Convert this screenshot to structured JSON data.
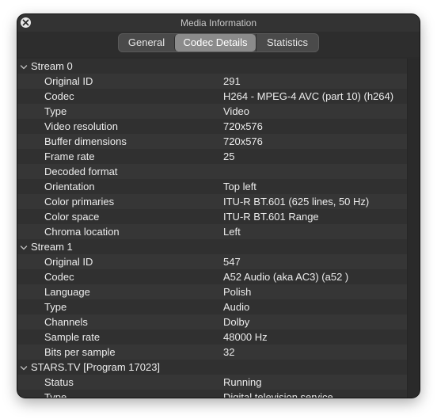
{
  "window": {
    "title": "Media Information"
  },
  "tabs": [
    {
      "label": "General",
      "selected": false
    },
    {
      "label": "Codec Details",
      "selected": true
    },
    {
      "label": "Statistics",
      "selected": false
    }
  ],
  "groups": [
    {
      "label": "Stream 0",
      "expanded": true,
      "properties": [
        {
          "label": "Original ID",
          "value": "291"
        },
        {
          "label": "Codec",
          "value": "H264 - MPEG-4 AVC (part 10) (h264)"
        },
        {
          "label": "Type",
          "value": "Video"
        },
        {
          "label": "Video resolution",
          "value": "720x576"
        },
        {
          "label": "Buffer dimensions",
          "value": "720x576"
        },
        {
          "label": "Frame rate",
          "value": "25"
        },
        {
          "label": "Decoded format",
          "value": ""
        },
        {
          "label": "Orientation",
          "value": "Top left"
        },
        {
          "label": "Color primaries",
          "value": "ITU-R BT.601 (625 lines, 50 Hz)"
        },
        {
          "label": "Color space",
          "value": "ITU-R BT.601 Range"
        },
        {
          "label": "Chroma location",
          "value": "Left"
        }
      ]
    },
    {
      "label": "Stream 1",
      "expanded": true,
      "properties": [
        {
          "label": "Original ID",
          "value": "547"
        },
        {
          "label": "Codec",
          "value": "A52 Audio (aka AC3) (a52 )"
        },
        {
          "label": "Language",
          "value": "Polish"
        },
        {
          "label": "Type",
          "value": "Audio"
        },
        {
          "label": "Channels",
          "value": "Dolby"
        },
        {
          "label": "Sample rate",
          "value": "48000 Hz"
        },
        {
          "label": "Bits per sample",
          "value": "32"
        }
      ]
    },
    {
      "label": "STARS.TV [Program 17023]",
      "expanded": true,
      "properties": [
        {
          "label": "Status",
          "value": "Running"
        },
        {
          "label": "Type",
          "value": "Digital television service"
        }
      ]
    }
  ],
  "icons": {
    "close": "close-icon",
    "disclosure": "chevron-down-icon"
  },
  "colors": {
    "window_bg": "#303030",
    "row_alt": "#363636",
    "text": "#ececec",
    "selected_tab": "#8b8b8b"
  }
}
